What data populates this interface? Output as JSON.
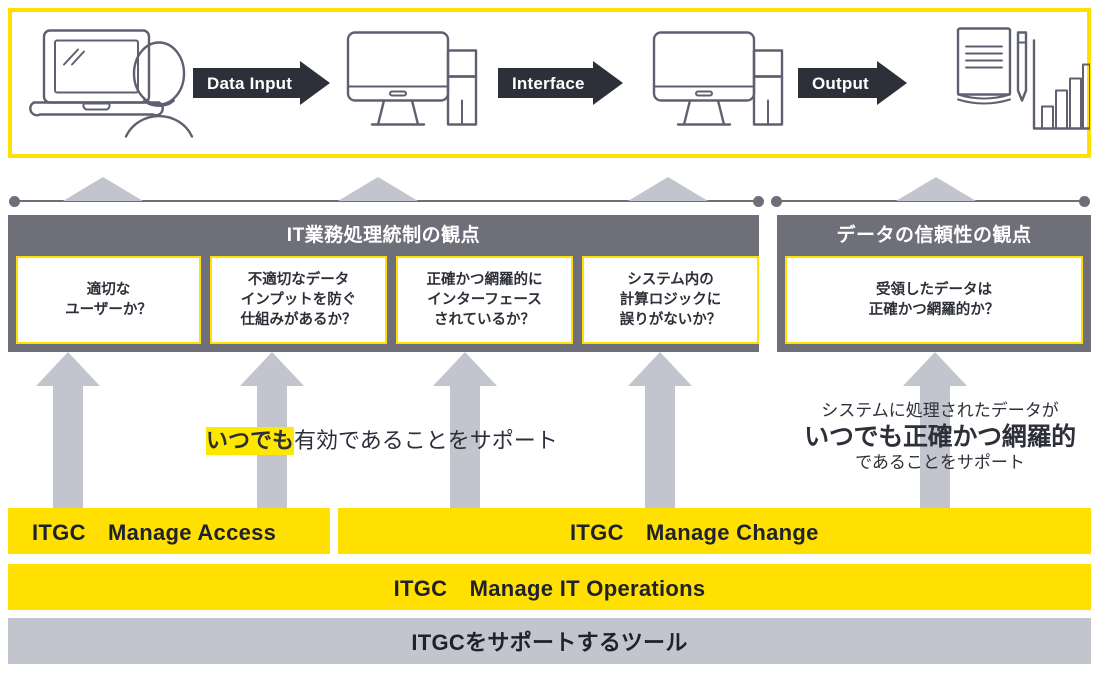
{
  "flow": {
    "icons": [
      {
        "name": "laptop-user-icon"
      },
      {
        "name": "desktop-computer-icon"
      },
      {
        "name": "desktop-computer-icon"
      },
      {
        "name": "report-document-chart-icon"
      }
    ],
    "arrows": [
      {
        "label": "Data Input"
      },
      {
        "label": "Interface"
      },
      {
        "label": "Output"
      }
    ]
  },
  "perspectives": [
    {
      "title": "IT業務処理統制の観点",
      "questions": [
        "適切な\nユーザーか？",
        "不適切なデータ\nインプットを防ぐ\n仕組みがあるか？",
        "正確かつ網羅的に\nインターフェース\nされているか？",
        "システム内の\n計算ロジックに\n誤りがないか？"
      ]
    },
    {
      "title": "データの信頼性の観点",
      "questions": [
        "受領したデータは\n正確かつ網羅的か？"
      ]
    }
  ],
  "support_left": {
    "highlight": "いつでも",
    "rest": "有効であることをサポート"
  },
  "support_right": {
    "line1": "システムに処理されたデータが",
    "line2": "いつでも正確かつ網羅的",
    "line3": "であることをサポート"
  },
  "bars": {
    "manage_access": "ITGC　Manage Access",
    "manage_change": "ITGC　Manage Change",
    "manage_it_operations": "ITGC　Manage IT Operations",
    "support_tools": "ITGCをサポートするツール"
  },
  "colors": {
    "brand_yellow": "#FFE000",
    "highlight_yellow": "#FFE800",
    "dark_slate": "#2E3039",
    "grey_panel": "#6E6F79",
    "grey_light": "#C3C5CE",
    "icon_stroke": "#5E6070"
  }
}
